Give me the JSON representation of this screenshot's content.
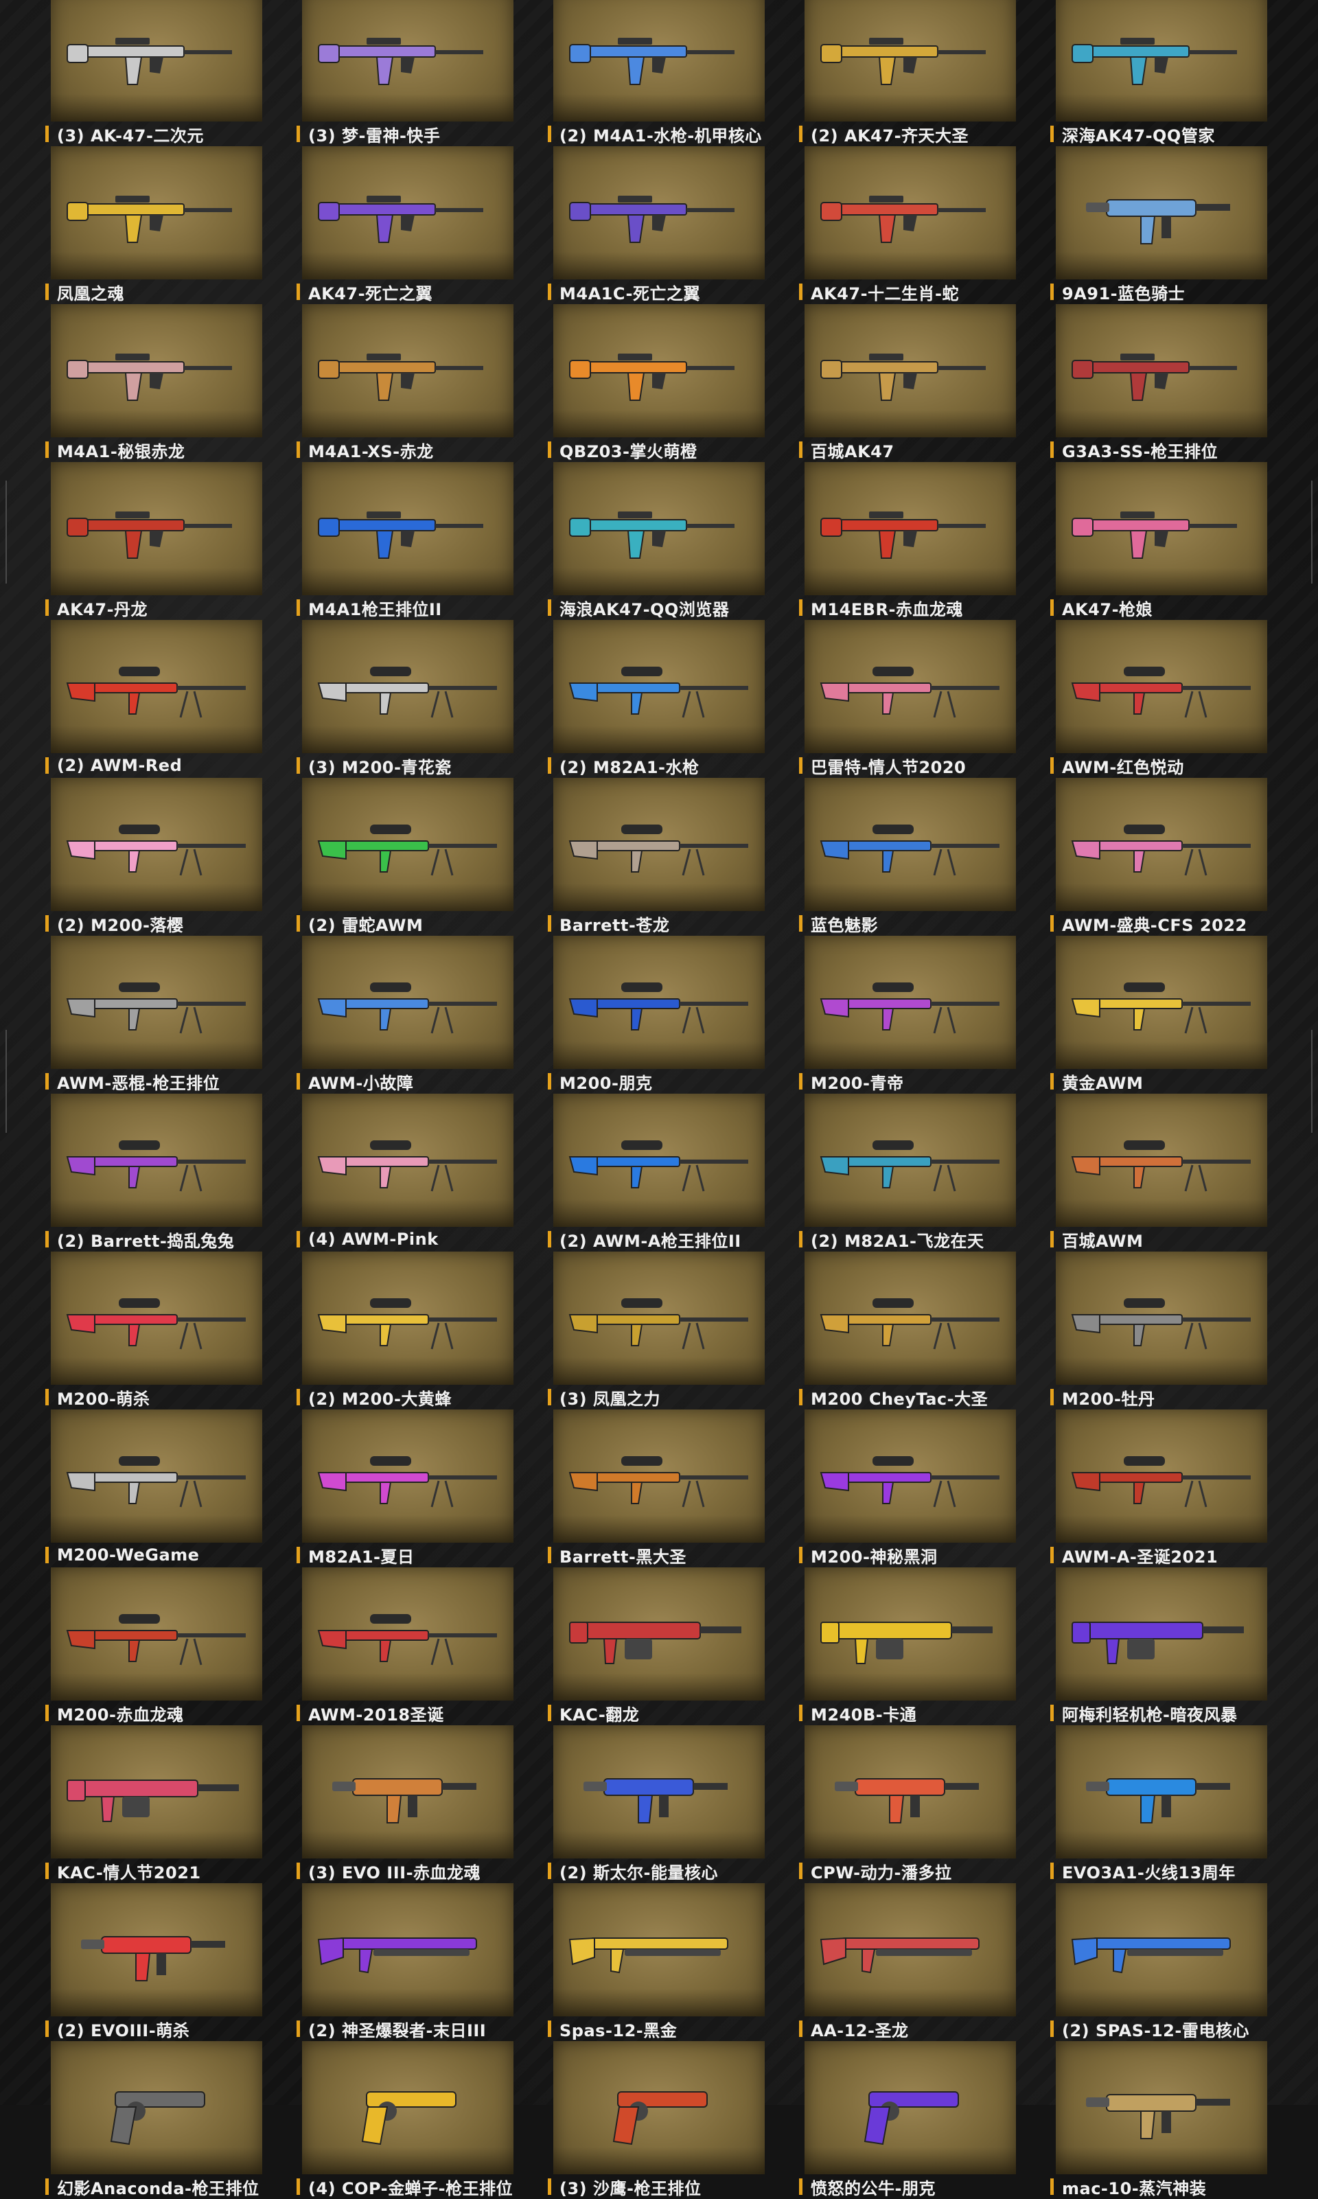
{
  "items": [
    {
      "label": "(3) AK-47-二次元",
      "icon": "rifle-icon",
      "color": "#c9c9c9"
    },
    {
      "label": "(3) 梦-雷神-快手",
      "icon": "rifle-icon",
      "color": "#9b7bd8"
    },
    {
      "label": "(2) M4A1-水枪-机甲核心",
      "icon": "rifle-icon",
      "color": "#4c89e0"
    },
    {
      "label": "(2) AK47-齐天大圣",
      "icon": "rifle-icon",
      "color": "#d4a83a"
    },
    {
      "label": "深海AK47-QQ管家",
      "icon": "rifle-icon",
      "color": "#3fa6c6"
    },
    {
      "label": "凤凰之魂",
      "icon": "rifle-icon",
      "color": "#e0b734"
    },
    {
      "label": "AK47-死亡之翼",
      "icon": "rifle-icon",
      "color": "#7a4fd0"
    },
    {
      "label": "M4A1C-死亡之翼",
      "icon": "rifle-icon",
      "color": "#6a4fc8"
    },
    {
      "label": "AK47-十二生肖-蛇",
      "icon": "rifle-icon",
      "color": "#d24a3a"
    },
    {
      "label": "9A91-蓝色骑士",
      "icon": "smg-icon",
      "color": "#6fa3d8"
    },
    {
      "label": "M4A1-秘银赤龙",
      "icon": "rifle-icon",
      "color": "#d0a0a0"
    },
    {
      "label": "M4A1-XS-赤龙",
      "icon": "rifle-icon",
      "color": "#c88a3a"
    },
    {
      "label": "QBZ03-掌火萌橙",
      "icon": "rifle-icon",
      "color": "#e88a2a"
    },
    {
      "label": "百城AK47",
      "icon": "rifle-icon",
      "color": "#c69a4a"
    },
    {
      "label": "G3A3-SS-枪王排位",
      "icon": "rifle-icon",
      "color": "#b03a3a"
    },
    {
      "label": "AK47-丹龙",
      "icon": "rifle-icon",
      "color": "#c43a2a"
    },
    {
      "label": "M4A1枪王排位II",
      "icon": "rifle-icon",
      "color": "#2a6ad8"
    },
    {
      "label": "海浪AK47-QQ浏览器",
      "icon": "rifle-icon",
      "color": "#3ab0c0"
    },
    {
      "label": "M14EBR-赤血龙魂",
      "icon": "rifle-icon",
      "color": "#d03a2a"
    },
    {
      "label": "AK47-枪娘",
      "icon": "rifle-icon",
      "color": "#e06a9a"
    },
    {
      "label": "(2) AWM-Red",
      "icon": "sniper-icon",
      "color": "#d83a2a"
    },
    {
      "label": "(3) M200-青花瓷",
      "icon": "sniper-icon",
      "color": "#c8c8c8"
    },
    {
      "label": "(2) M82A1-水枪",
      "icon": "sniper-icon",
      "color": "#3a8ae0"
    },
    {
      "label": "巴雷特-情人节2020",
      "icon": "sniper-icon",
      "color": "#e07a9a"
    },
    {
      "label": "AWM-红色悦动",
      "icon": "sniper-icon",
      "color": "#d03a3a"
    },
    {
      "label": "(2) M200-落樱",
      "icon": "sniper-icon",
      "color": "#f0a0c8"
    },
    {
      "label": "(2) 雷蛇AWM",
      "icon": "sniper-icon",
      "color": "#3ac04a"
    },
    {
      "label": "Barrett-苍龙",
      "icon": "sniper-icon",
      "color": "#b0a090"
    },
    {
      "label": "蓝色魅影",
      "icon": "sniper-icon",
      "color": "#3a7ad8"
    },
    {
      "label": "AWM-盛典-CFS 2022",
      "icon": "sniper-icon",
      "color": "#e07ab0"
    },
    {
      "label": "AWM-恶棍-枪王排位",
      "icon": "sniper-icon",
      "color": "#a0a0a0"
    },
    {
      "label": "AWM-小故障",
      "icon": "sniper-icon",
      "color": "#4a8ae0"
    },
    {
      "label": "M200-朋克",
      "icon": "sniper-icon",
      "color": "#2a5ad0"
    },
    {
      "label": "M200-青帝",
      "icon": "sniper-icon",
      "color": "#b04ad0"
    },
    {
      "label": "黄金AWM",
      "icon": "sniper-icon",
      "color": "#e8c23a"
    },
    {
      "label": "(2) Barrett-捣乱兔兔",
      "icon": "sniper-icon",
      "color": "#a04ad0"
    },
    {
      "label": "(4) AWM-Pink",
      "icon": "sniper-icon",
      "color": "#e89ab8"
    },
    {
      "label": "(2) AWM-A枪王排位II",
      "icon": "sniper-icon",
      "color": "#2a7ae0"
    },
    {
      "label": "(2) M82A1-飞龙在天",
      "icon": "sniper-icon",
      "color": "#3aa0c0"
    },
    {
      "label": "百城AWM",
      "icon": "sniper-icon",
      "color": "#d0703a"
    },
    {
      "label": "M200-萌杀",
      "icon": "sniper-icon",
      "color": "#e03a4a"
    },
    {
      "label": "(2) M200-大黄蜂",
      "icon": "sniper-icon",
      "color": "#e8c03a"
    },
    {
      "label": "(3) 凤凰之力",
      "icon": "sniper-icon",
      "color": "#c8a030"
    },
    {
      "label": "M200 CheyTac-大圣",
      "icon": "sniper-icon",
      "color": "#d0a03a"
    },
    {
      "label": "M200-牡丹",
      "icon": "sniper-icon",
      "color": "#8a8a8a"
    },
    {
      "label": "M200-WeGame",
      "icon": "sniper-icon",
      "color": "#c0c0c0"
    },
    {
      "label": "M82A1-夏日",
      "icon": "sniper-icon",
      "color": "#d04ad0"
    },
    {
      "label": "Barrett-黑大圣",
      "icon": "sniper-icon",
      "color": "#d07a2a"
    },
    {
      "label": "M200-神秘黑洞",
      "icon": "sniper-icon",
      "color": "#9a3ae0"
    },
    {
      "label": "AWM-A-圣诞2021",
      "icon": "sniper-icon",
      "color": "#c03a2a"
    },
    {
      "label": "M200-赤血龙魂",
      "icon": "sniper-icon",
      "color": "#c8402a"
    },
    {
      "label": "AWM-2018圣诞",
      "icon": "sniper-icon",
      "color": "#d03a3a"
    },
    {
      "label": "KAC-翻龙",
      "icon": "mg-icon",
      "color": "#c83a3a"
    },
    {
      "label": "M240B-卡通",
      "icon": "mg-icon",
      "color": "#e8c02a"
    },
    {
      "label": "阿梅利轻机枪-暗夜风暴",
      "icon": "mg-icon",
      "color": "#6a3ad8"
    },
    {
      "label": "KAC-情人节2021",
      "icon": "mg-icon",
      "color": "#d84a6a"
    },
    {
      "label": "(3) EVO III-赤血龙魂",
      "icon": "smg-icon",
      "color": "#d0803a"
    },
    {
      "label": "(2) 斯太尔-能量核心",
      "icon": "smg-icon",
      "color": "#3a5ad8"
    },
    {
      "label": "CPW-动力-潘多拉",
      "icon": "smg-icon",
      "color": "#e05a3a"
    },
    {
      "label": "EVO3A1-火线13周年",
      "icon": "smg-icon",
      "color": "#2a8ae0"
    },
    {
      "label": "(2) EVOIII-萌杀",
      "icon": "smg-icon",
      "color": "#e03a3a"
    },
    {
      "label": "(2) 神圣爆裂者-末日III",
      "icon": "shotgun-icon",
      "color": "#8a3ad8"
    },
    {
      "label": "Spas-12-黑金",
      "icon": "shotgun-icon",
      "color": "#e8c03a"
    },
    {
      "label": "AA-12-圣龙",
      "icon": "shotgun-icon",
      "color": "#d04a4a"
    },
    {
      "label": "(2) SPAS-12-雷电核心",
      "icon": "shotgun-icon",
      "color": "#3a7ae0"
    },
    {
      "label": "幻影Anaconda-枪王排位",
      "icon": "pistol-icon",
      "color": "#6a6a6a"
    },
    {
      "label": "(4) COP-金蝉子-枪王排位",
      "icon": "pistol-icon",
      "color": "#e8b82a"
    },
    {
      "label": "(3) 沙鹰-枪王排位",
      "icon": "pistol-icon",
      "color": "#d04a2a"
    },
    {
      "label": "愤怒的公牛-朋克",
      "icon": "pistol-icon",
      "color": "#6a3ad8"
    },
    {
      "label": "mac-10-蒸汽神装",
      "icon": "smg-icon",
      "color": "#c0a060"
    }
  ]
}
